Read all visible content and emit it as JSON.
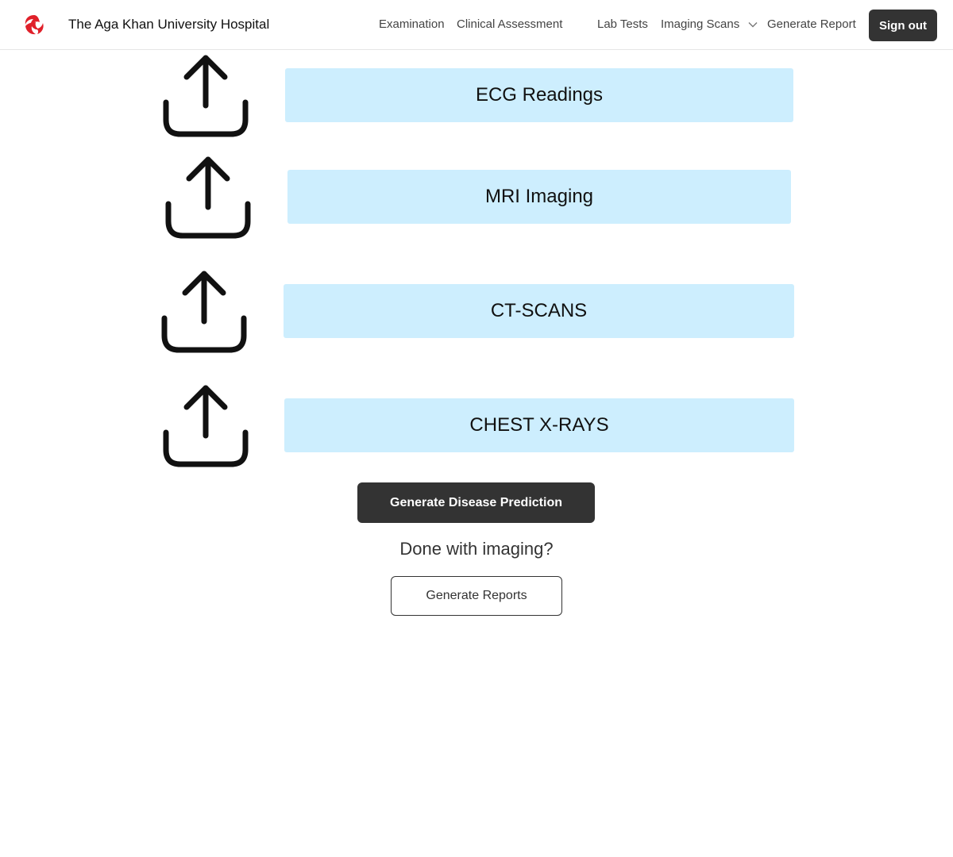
{
  "header": {
    "brand": "The Aga Khan University Hospital",
    "logo_color": "#e0202a",
    "nav": {
      "examination": "Examination",
      "clinical_assessment": "Clinical Assessment",
      "lab_tests": "Lab Tests",
      "imaging_scans": "Imaging Scans",
      "generate_report": "Generate Report"
    },
    "sign_out": "Sign out"
  },
  "uploads": [
    {
      "label": "ECG Readings",
      "icon": "upload-icon"
    },
    {
      "label": "MRI Imaging",
      "icon": "upload-icon"
    },
    {
      "label": "CT-SCANS",
      "icon": "upload-icon"
    },
    {
      "label": "CHEST X-RAYS",
      "icon": "upload-icon"
    }
  ],
  "actions": {
    "predict": "Generate Disease Prediction",
    "done_prompt": "Done with imaging?",
    "reports": "Generate Reports"
  },
  "colors": {
    "scan_button_bg": "#cdeefe",
    "dark_button_bg": "#333333"
  }
}
